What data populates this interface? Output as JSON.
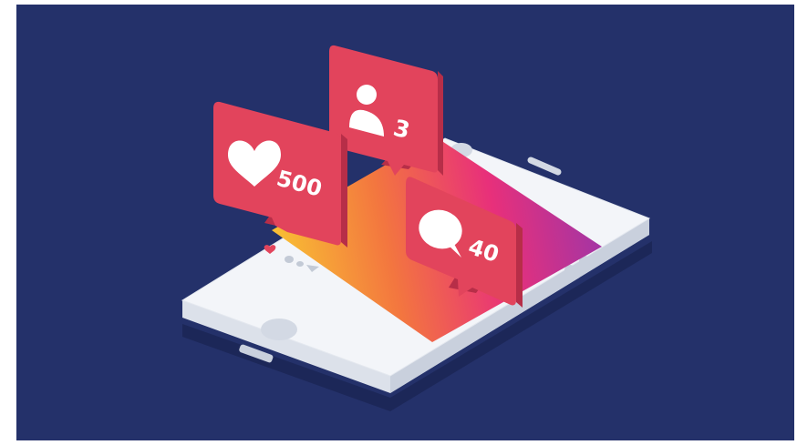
{
  "colors": {
    "background": "#24316A",
    "frame": "#FFFFFF",
    "phone_top": "#F3F5F9",
    "phone_side": "#DCE1EA",
    "phone_shadow": "#1B2655",
    "badge_face": "#E2445C",
    "badge_side": "#B72E48",
    "gradient": [
      "#F9C433",
      "#F3763F",
      "#E8307A",
      "#9F35A7"
    ]
  },
  "notifications": {
    "followers": {
      "icon": "user-icon",
      "count": "3"
    },
    "likes": {
      "icon": "heart-icon",
      "count": "500"
    },
    "comments": {
      "icon": "speech-bubble-icon",
      "count": "40"
    }
  },
  "screen_actions": {
    "like": "heart-icon",
    "comment": "comment-icon",
    "share": "send-icon"
  }
}
